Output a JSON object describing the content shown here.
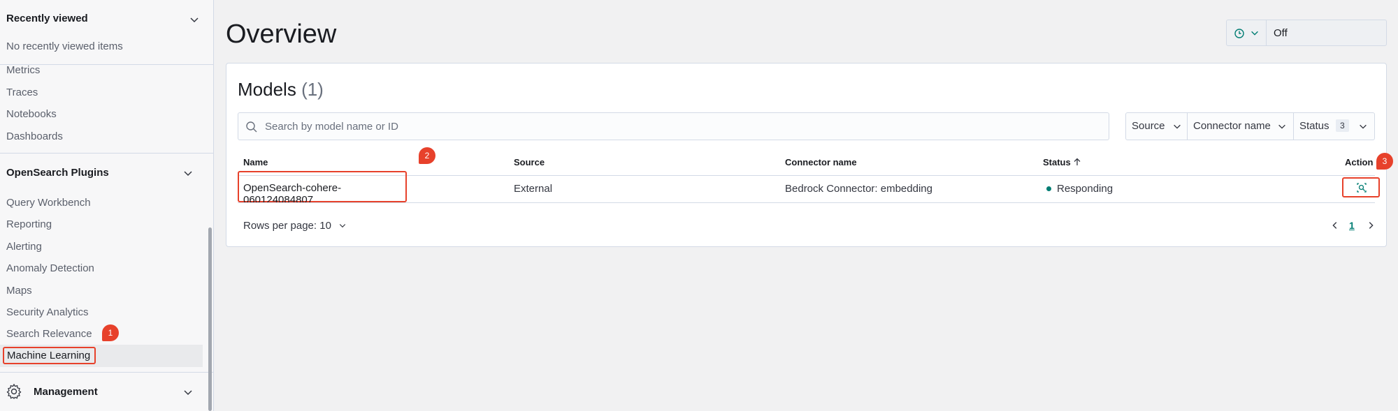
{
  "sidebar": {
    "recently_viewed": {
      "title": "Recently viewed",
      "empty_text": "No recently viewed items"
    },
    "observability_items": [
      "Metrics",
      "Traces",
      "Notebooks",
      "Dashboards"
    ],
    "plugins": {
      "title": "OpenSearch Plugins",
      "items": [
        "Query Workbench",
        "Reporting",
        "Alerting",
        "Anomaly Detection",
        "Maps",
        "Security Analytics",
        "Search Relevance"
      ],
      "selected": "Machine Learning"
    },
    "management": {
      "title": "Management"
    }
  },
  "annotations": {
    "badge1": "1",
    "badge2": "2",
    "badge3": "3"
  },
  "header": {
    "title": "Overview",
    "refresh": {
      "value": "Off",
      "icon": "clock-icon"
    }
  },
  "models": {
    "title": "Models",
    "count": "(1)",
    "search_placeholder": "Search by model name or ID",
    "filters": {
      "source": "Source",
      "connector": "Connector name",
      "status": "Status",
      "status_count": "3"
    },
    "columns": {
      "name": "Name",
      "source": "Source",
      "connector": "Connector name",
      "status": "Status",
      "action": "Action"
    },
    "rows": [
      {
        "name": "OpenSearch-cohere-060124084807",
        "source": "External",
        "connector": "Bedrock Connector: embedding",
        "status": "Responding",
        "status_color": "#017d73"
      }
    ],
    "rows_per_page": "Rows per page: 10",
    "current_page": "1"
  },
  "colors": {
    "accent": "#017d73",
    "highlight": "#e7412b"
  }
}
